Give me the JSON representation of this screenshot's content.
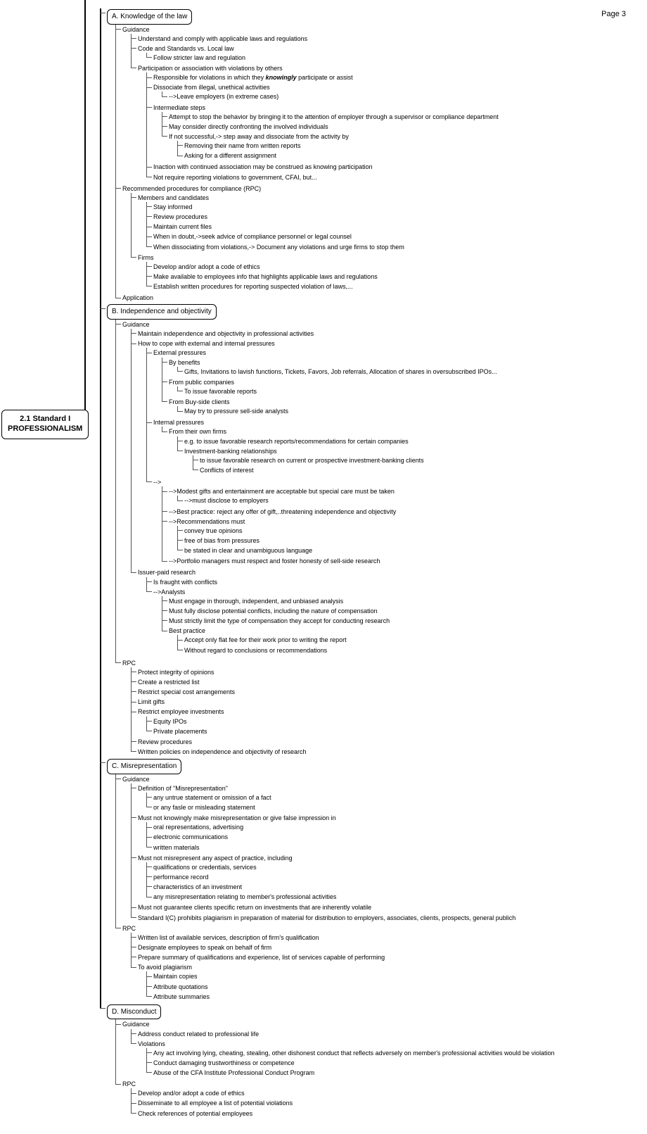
{
  "page_number": "Page 3",
  "root": {
    "line1": "2.1 Standard I",
    "line2": "PROFESSIONALISM"
  },
  "A": {
    "title": "A. Knowledge of the law",
    "guidance_label": "Guidance",
    "g1": "Understand and comply with applicable laws and regulations",
    "g2": "Code and Standards vs. Local law",
    "g2a": "Follow stricter law and regulation",
    "part_label": "Participation or association with violations by others",
    "p1_a": "Responsible for violations in which they ",
    "p1_b": "knowingly",
    "p1_c": " participate or assist",
    "p2": "Dissociate from illegal, unethical activities",
    "p2a": "-->Leave employers (in extreme cases)",
    "intermediate_label": "Intermediate steps",
    "i1": "Attempt to stop the behavior by bringing it to the attention of employer through a supervisor or compliance department",
    "i2": "May consider directly confronting the involved individuals",
    "i3": "If not successful,-> step away and dissociate from the activity by",
    "i3a": "Removing their name from written reports",
    "i3b": "Asking for a different assignment",
    "p3": "Inaction with continued association may be construed as knowing participation",
    "p4": "Not require reporting violations to government, CFAI, but...",
    "rpc_label": "Recommended procedures for compliance (RPC)",
    "mc_label": "Members and candidates",
    "mc1": "Stay informed",
    "mc2": "Review procedures",
    "mc3": "Maintain current files",
    "mc4": "When in doubt,->seek advice of compliance personnel or legal counsel",
    "mc5": "When dissociating from violations,-> Document any violations and urge firms to stop them",
    "firms_label": "Firms",
    "f1": "Develop and/or adopt a code of ethics",
    "f2": "Make available to employees info that highlights applicable laws and regulations",
    "f3": "Establish written procedures for reporting suspected violation of laws,...",
    "app_label": "Application"
  },
  "B": {
    "title": "B. Independence and objectivity",
    "guidance_label": "Guidance",
    "g1": "Maintain independence and objectivity in professional activities",
    "cope_label": "How to cope with external and internal pressures",
    "ext_label": "External pressures",
    "ext_ben_label": "By benefits",
    "ext_ben_detail": "Gifts, Invitations to lavish functions, Tickets, Favors, Job referrals, Allocation of shares in oversubscribed IPOs...",
    "ext_pub_label": "From public companies",
    "ext_pub_detail": "To issue favorable reports",
    "ext_buy_label": "From Buy-side clients",
    "ext_buy_detail": "May try to pressure sell-side analysts",
    "int_label": "Internal pressures",
    "int_own_label": "From their own firms",
    "int_own_eg": "e.g. to issue favorable research reports/recommendations for certain companies",
    "int_ib_label": "Investment-banking relationships",
    "int_ib_1": "to issue favorable research on current or prospective investment-banking clients",
    "int_ib_2": "Conflicts of interest",
    "arrow_label": "-->",
    "a1": "-->Modest gifts and entertainment are acceptable but special care must be taken",
    "a1a": "-->must disclose to employers",
    "a2": "-->Best practice: reject any offer of gift,..threatening independence and objectivity",
    "rec_label": "-->Recommendations must",
    "rec1": "convey true opinions",
    "rec2": "free of bias from pressures",
    "rec3": "be stated in clear and unambiguous language",
    "a3": "-->Portfolio managers must respect and foster honesty of sell-side research",
    "iss_label": "Issuer-paid research",
    "iss1": "Is fraught with conflicts",
    "iss_an_label": "-->Analysts",
    "iss_an1": "Must engage in thorough, independent, and unbiased analysis",
    "iss_an2": "Must fully disclose potential conflicts, including the nature of compensation",
    "iss_an3": "Must strictly limit the type of compensation they accept for conducting research",
    "iss_bp_label": "Best practice",
    "iss_bp1": "Accept only flat fee for their work prior to writing the report",
    "iss_bp2": "Without regard to conclusions or recommendations",
    "rpc_label": "RPC",
    "r1": "Protect integrity of opinions",
    "r2": "Create a restricted list",
    "r3": "Restrict special cost arrangements",
    "r4": "Limit gifts",
    "r5": "Restrict employee investments",
    "r5a": "Equity IPOs",
    "r5b": "Private placements",
    "r6": "Review procedures",
    "r7": "Written policies on independence and objectivity of research"
  },
  "C": {
    "title": "C. Misrepresentation",
    "guidance_label": "Guidance",
    "def_label": "Definition of \"Misrepresentation\"",
    "def1": "any untrue statement or omission of a fact",
    "def2": "or any fasle or misleading statement",
    "know_label": "Must not knowingly make misrepresentation or give false impression in",
    "k1": "oral representations, advertising",
    "k2": "electronic communications",
    "k3": "written materials",
    "asp_label": "Must not misrepresent any aspect of practice, including",
    "a1": "qualifications or credentials, services",
    "a2": "performance record",
    "a3": "characteristics of an investment",
    "a4": "any misrepresentation relating to member's professional activities",
    "g4": "Must not guarantee clients specific return on investments that are inherently volatile",
    "g5": "Standard I(C) prohibits plagiarism in preparation of material for distribution to employers, associates, clients, prospects, general publich",
    "rpc_label": "RPC",
    "r1": "Written list of available services, description of firm's qualification",
    "r2": "Designate employees to speak on behalf of firm",
    "r3": "Prepare summary of qualifications and experience, list of services capable of performing",
    "r4_label": "To avoid plagiarism",
    "r4a": "Maintain copies",
    "r4b": "Attribute quotations",
    "r4c": "Attribute summaries"
  },
  "D": {
    "title": "D. Misconduct",
    "guidance_label": "Guidance",
    "g1": "Address conduct related to professional life",
    "viol_label": "Violations",
    "v1": "Any act involving lying, cheating, stealing, other dishonest conduct that reflects adversely on member's professional activities would be violation",
    "v2": "Conduct damaging trustworthiness or competence",
    "v3": "Abuse of the CFA Institute Professional Conduct Program",
    "rpc_label": "RPC",
    "r1": "Develop and/or adopt a code of ethics",
    "r2": "Disseminate to all employee a list of potential violations",
    "r3": "Check references of potential employees"
  }
}
